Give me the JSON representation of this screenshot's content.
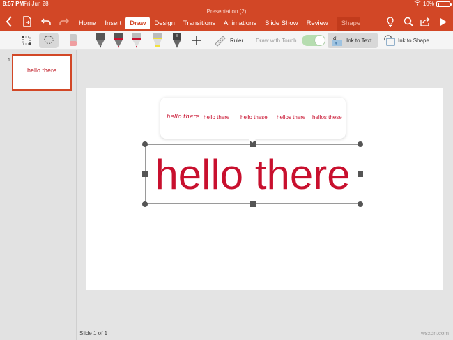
{
  "status": {
    "time": "8:57 PM",
    "date": "Fri Jun 28",
    "battery": "10%"
  },
  "document_title": "Presentation (2)",
  "tabs": [
    "Home",
    "Insert",
    "Draw",
    "Design",
    "Transitions",
    "Animations",
    "Slide Show",
    "Review",
    "Shape"
  ],
  "active_tab": "Draw",
  "draw_toolbar": {
    "ruler_label": "Ruler",
    "draw_with_touch_label": "Draw with Touch",
    "draw_with_touch_on": true,
    "ink_to_text_label": "Ink to Text",
    "ink_to_shape_label": "Ink to Shape",
    "pen_colors": [
      "#333333",
      "#c8102e",
      "#c8102e",
      "#f2e13a",
      "#555555"
    ]
  },
  "thumbnail": {
    "number": "1",
    "text": "hello there"
  },
  "slide": {
    "text": "hello there",
    "suggestions": [
      "hello there",
      "hello there",
      "hello these",
      "hellos there",
      "hellos these"
    ]
  },
  "footer": {
    "slide_counter": "Slide 1 of 1",
    "watermark": "wsxdn.com"
  },
  "colors": {
    "accent": "#d24726",
    "ink": "#c8102e"
  }
}
